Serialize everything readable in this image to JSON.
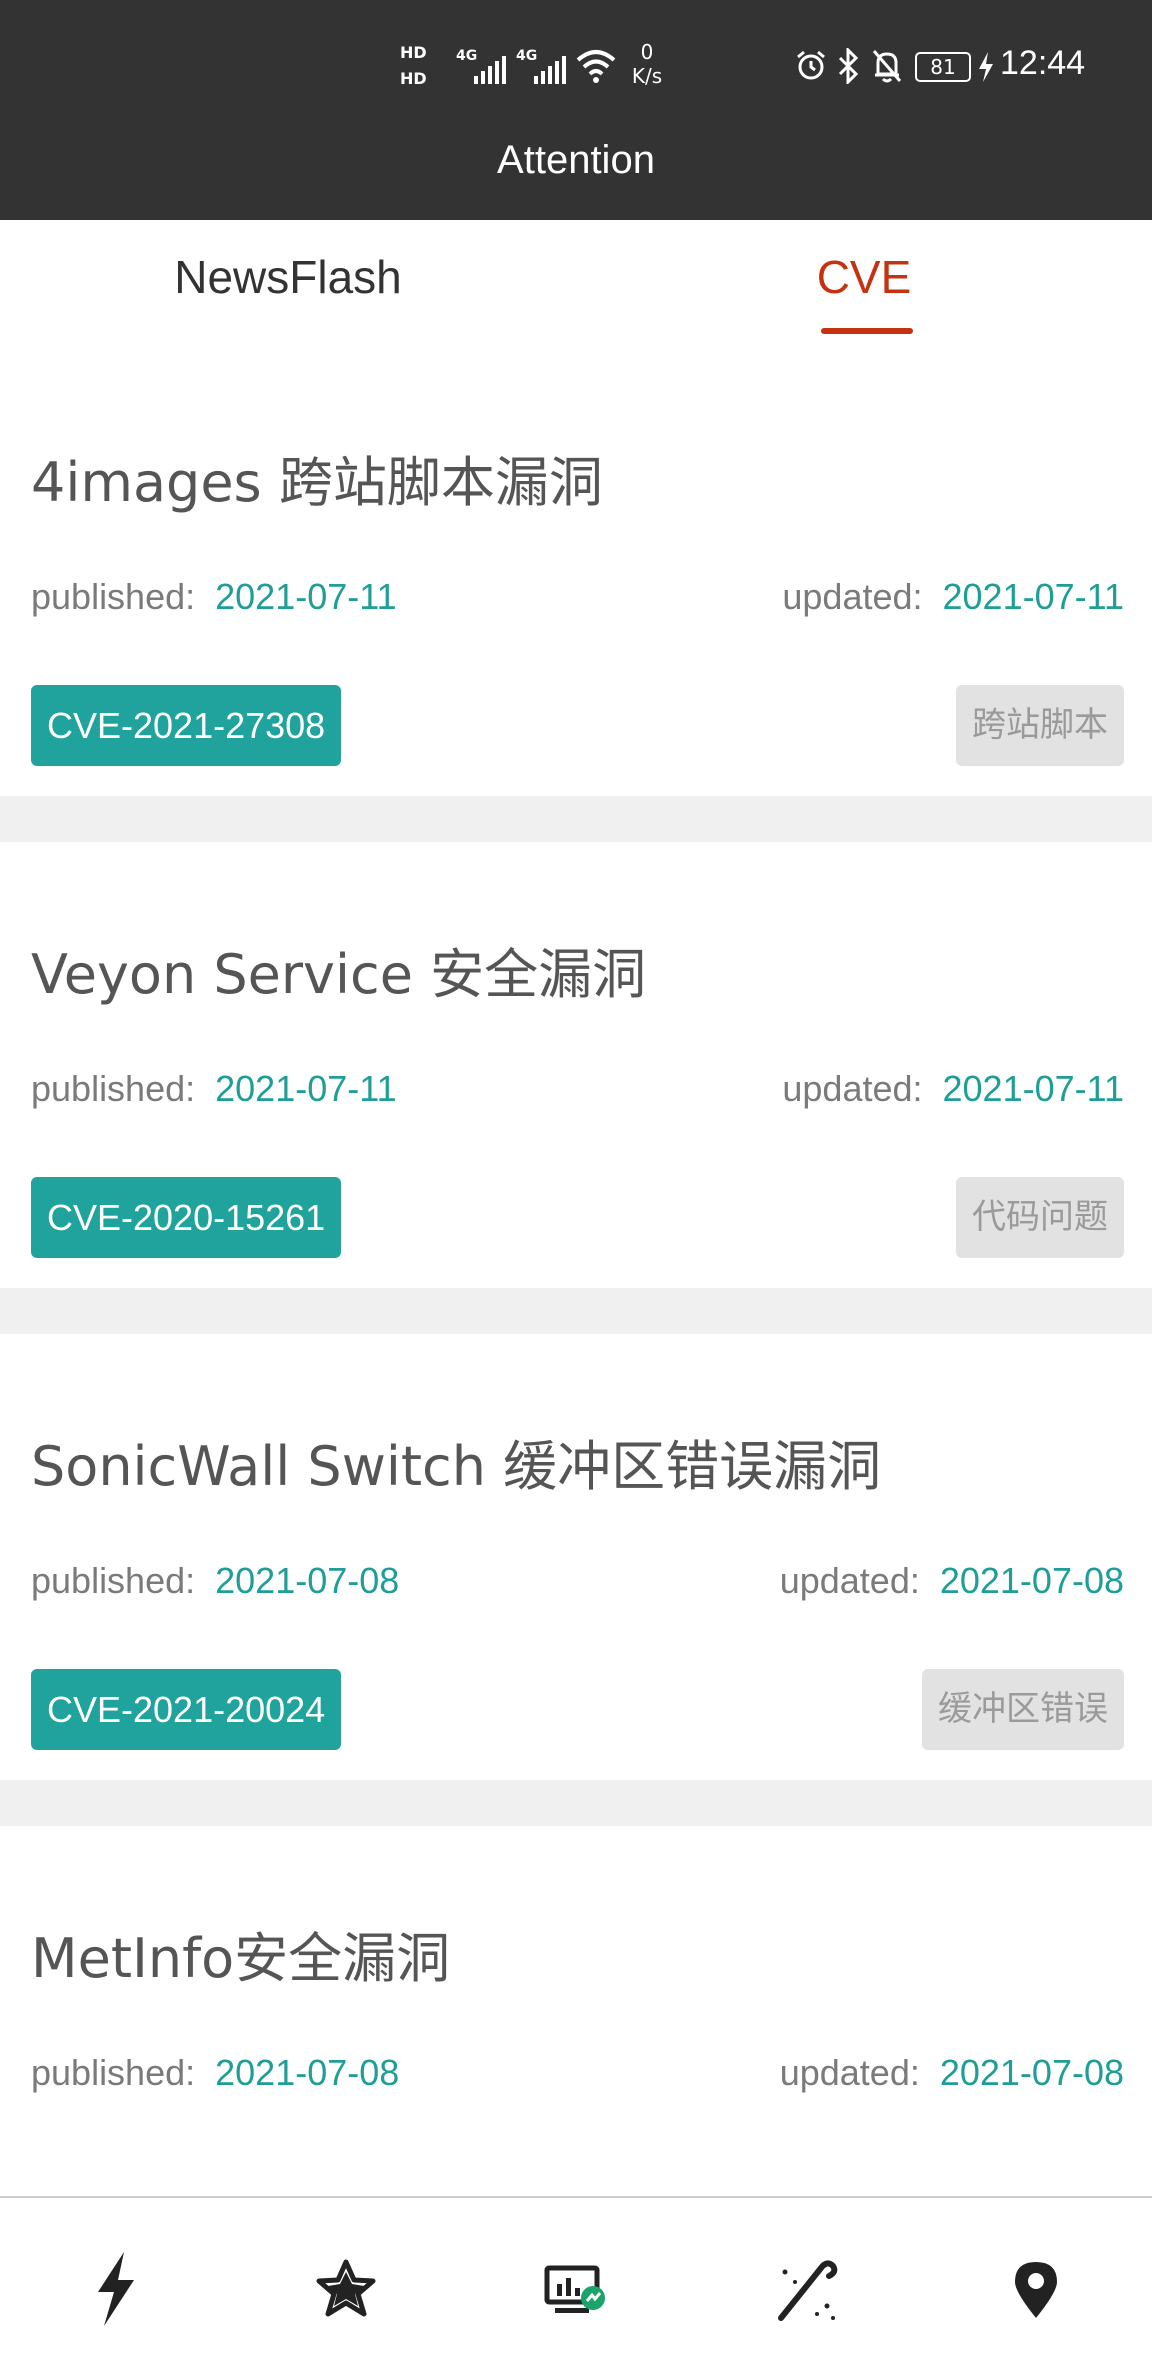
{
  "status_bar": {
    "hd1": "HD",
    "hd2": "HD",
    "net1": "4G",
    "net2": "4G",
    "speed_value": "0",
    "speed_unit": "K/s",
    "battery": "81",
    "time": "12:44"
  },
  "header": {
    "title": "Attention"
  },
  "tabs": [
    {
      "label": "NewsFlash",
      "active": false
    },
    {
      "label": "CVE",
      "active": true
    }
  ],
  "labels": {
    "published": "published:",
    "updated": "updated:"
  },
  "items": [
    {
      "title": "4images 跨站脚本漏洞",
      "published": "2021-07-11",
      "updated": "2021-07-11",
      "cve": "CVE-2021-27308",
      "type": "跨站脚本"
    },
    {
      "title": "Veyon Service 安全漏洞",
      "published": "2021-07-11",
      "updated": "2021-07-11",
      "cve": "CVE-2020-15261",
      "type": "代码问题"
    },
    {
      "title": "SonicWall Switch 缓冲区错误漏洞",
      "published": "2021-07-08",
      "updated": "2021-07-08",
      "cve": "CVE-2021-20024",
      "type": "缓冲区错误"
    },
    {
      "title": "MetInfo安全漏洞",
      "published": "2021-07-08",
      "updated": "2021-07-08"
    }
  ],
  "bottom_nav": [
    {
      "icon": "lightning-icon"
    },
    {
      "icon": "star-icon"
    },
    {
      "icon": "monitor-chart-icon"
    },
    {
      "icon": "wand-icon"
    },
    {
      "icon": "location-pin-icon"
    }
  ],
  "colors": {
    "header_bg": "#333333",
    "accent_red": "#c4330f",
    "teal": "#20a39c",
    "date_teal": "#1f9e98",
    "separator": "#f0f0f0"
  }
}
